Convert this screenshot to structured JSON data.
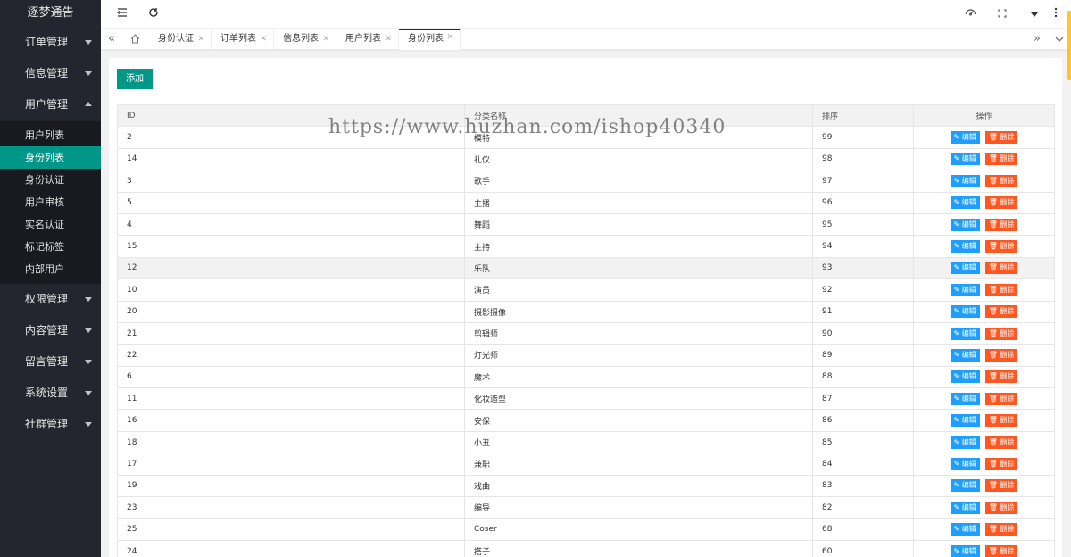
{
  "app": {
    "title": "逐梦通告"
  },
  "sidebar": {
    "groups": [
      {
        "label": "订单管理"
      },
      {
        "label": "信息管理"
      },
      {
        "label": "用户管理",
        "open": true,
        "items": [
          "用户列表",
          "身份列表",
          "身份认证",
          "用户审核",
          "实名认证",
          "标记标签",
          "内部用户"
        ]
      },
      {
        "label": "权限管理"
      },
      {
        "label": "内容管理"
      },
      {
        "label": "留言管理"
      },
      {
        "label": "系统设置"
      },
      {
        "label": "社群管理"
      }
    ],
    "active_item": "身份列表"
  },
  "topbar": {
    "icons": [
      "shrink-sidebar-icon",
      "refresh-icon",
      "theme-icon",
      "fullscreen-icon",
      "user-dropdown-icon",
      "more-icon"
    ]
  },
  "tabs": [
    {
      "label": "身份认证"
    },
    {
      "label": "订单列表"
    },
    {
      "label": "信息列表"
    },
    {
      "label": "用户列表"
    },
    {
      "label": "身份列表",
      "active": true
    }
  ],
  "toolbar": {
    "add_label": "添加"
  },
  "table": {
    "headers": [
      "ID",
      "分类名称",
      "排序",
      "操作"
    ],
    "edit_label": "✎ 编辑",
    "delete_label": "🗑 删除",
    "rows": [
      [
        "2",
        "模特",
        "99"
      ],
      [
        "14",
        "礼仪",
        "98"
      ],
      [
        "3",
        "歌手",
        "97"
      ],
      [
        "5",
        "主播",
        "96"
      ],
      [
        "4",
        "舞蹈",
        "95"
      ],
      [
        "15",
        "主持",
        "94"
      ],
      [
        "12",
        "乐队",
        "93"
      ],
      [
        "10",
        "演员",
        "92"
      ],
      [
        "20",
        "摄影摄像",
        "91"
      ],
      [
        "21",
        "剪辑师",
        "90"
      ],
      [
        "22",
        "灯光师",
        "89"
      ],
      [
        "6",
        "魔术",
        "88"
      ],
      [
        "11",
        "化妆造型",
        "87"
      ],
      [
        "16",
        "安保",
        "86"
      ],
      [
        "18",
        "小丑",
        "85"
      ],
      [
        "17",
        "兼职",
        "84"
      ],
      [
        "19",
        "戏曲",
        "83"
      ],
      [
        "23",
        "编导",
        "82"
      ],
      [
        "25",
        "Coser",
        "68"
      ],
      [
        "24",
        "搭子",
        "60"
      ]
    ]
  },
  "watermark": "https://www.huzhan.com/ishop40340",
  "colors": {
    "sidebar": "#23262e",
    "accent": "#009688",
    "edit": "#1e9fff",
    "delete": "#ff5722"
  }
}
